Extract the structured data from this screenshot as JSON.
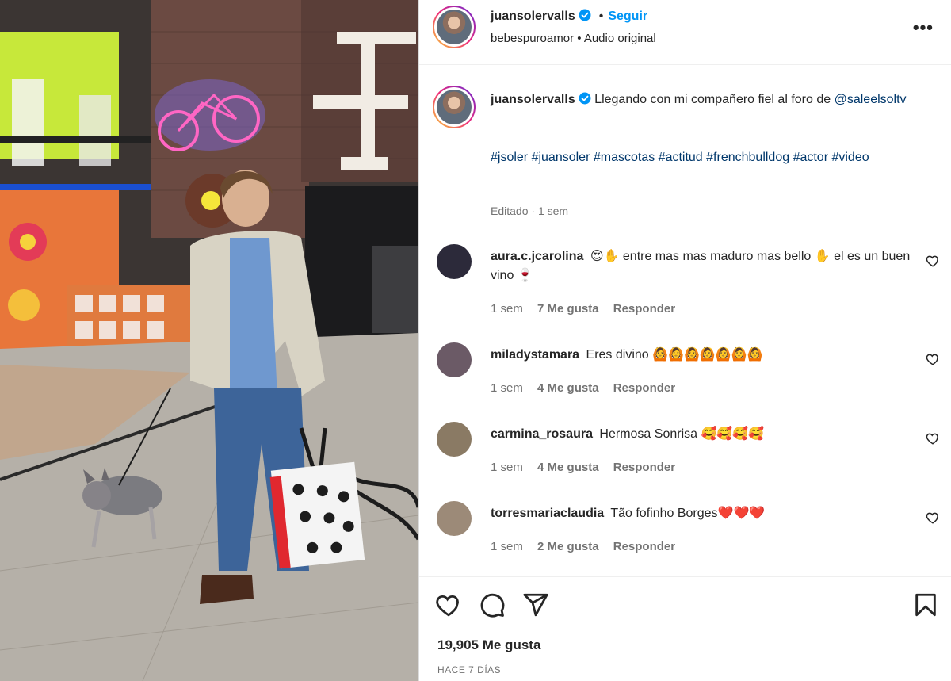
{
  "post": {
    "username": "juansolervalls",
    "separator": "•",
    "follow_label": "Seguir",
    "audio_line": "bebespuroamor • Audio original",
    "more_label": "•••"
  },
  "caption": {
    "username": "juansolervalls",
    "text": "Llegando con mi compañero fiel al foro de",
    "mention": "@saleelsoltv",
    "hashtags": "#jsoler #juansoler #mascotas #actitud #frenchbulldog #actor #video",
    "edited": "Editado",
    "edited_sep": "·",
    "time": "1 sem"
  },
  "comments": [
    {
      "username": "aura.c.jcarolina",
      "text": "😍✋ entre mas mas maduro mas bello ✋ el es un buen vino 🍷",
      "time": "1 sem",
      "likes": "7 Me gusta",
      "reply": "Responder",
      "avatar_color": "#2c2a3a"
    },
    {
      "username": "miladystamara",
      "text": "Eres divino 🙆🙆🙆🙆🙆🙆🙆",
      "time": "1 sem",
      "likes": "4 Me gusta",
      "reply": "Responder",
      "avatar_color": "#6b5a66"
    },
    {
      "username": "carmina_rosaura",
      "text": "Hermosa Sonrisa 🥰🥰🥰🥰",
      "time": "1 sem",
      "likes": "4 Me gusta",
      "reply": "Responder",
      "avatar_color": "#8a7a64"
    },
    {
      "username": "torresmariaclaudia",
      "text": "Tão fofinho Borges❤️❤️❤️",
      "time": "1 sem",
      "likes": "2 Me gusta",
      "reply": "Responder",
      "avatar_color": "#9c8a78"
    }
  ],
  "footer": {
    "likes_total": "19,905 Me gusta",
    "posted": "HACE 7 DÍAS"
  },
  "icons": {
    "verified": "verified-badge-icon",
    "heart": "heart-icon",
    "comment": "comment-icon",
    "share": "share-icon",
    "save": "bookmark-icon",
    "more": "more-options-icon"
  },
  "colors": {
    "link": "#0095f6",
    "hashtag": "#00376b",
    "muted": "#737373",
    "text": "#262626"
  }
}
